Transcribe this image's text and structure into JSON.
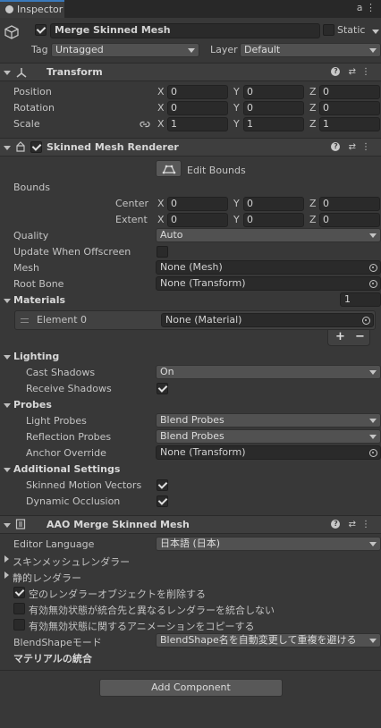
{
  "tab": {
    "title": "Inspector"
  },
  "object": {
    "name": "Merge Skinned Mesh",
    "static_label": "Static",
    "tag_label": "Tag",
    "tag_value": "Untagged",
    "layer_label": "Layer",
    "layer_value": "Default"
  },
  "transform": {
    "title": "Transform",
    "position": {
      "label": "Position",
      "x": "0",
      "y": "0",
      "z": "0"
    },
    "rotation": {
      "label": "Rotation",
      "x": "0",
      "y": "0",
      "z": "0"
    },
    "scale": {
      "label": "Scale",
      "x": "1",
      "y": "1",
      "z": "1"
    }
  },
  "axes": {
    "x": "X",
    "y": "Y",
    "z": "Z"
  },
  "smr": {
    "title": "Skinned Mesh Renderer",
    "edit_bounds": "Edit Bounds",
    "bounds_label": "Bounds",
    "center": {
      "label": "Center",
      "x": "0",
      "y": "0",
      "z": "0"
    },
    "extent": {
      "label": "Extent",
      "x": "0",
      "y": "0",
      "z": "0"
    },
    "quality_label": "Quality",
    "quality_value": "Auto",
    "update_offscreen_label": "Update When Offscreen",
    "mesh_label": "Mesh",
    "mesh_value": "None (Mesh)",
    "root_bone_label": "Root Bone",
    "root_bone_value": "None (Transform)",
    "materials_label": "Materials",
    "materials_count": "1",
    "element0_label": "Element 0",
    "element0_value": "None (Material)",
    "plus": "+",
    "minus": "−",
    "lighting_label": "Lighting",
    "cast_shadows_label": "Cast Shadows",
    "cast_shadows_value": "On",
    "receive_shadows_label": "Receive Shadows",
    "probes_label": "Probes",
    "light_probes_label": "Light Probes",
    "light_probes_value": "Blend Probes",
    "reflection_probes_label": "Reflection Probes",
    "reflection_probes_value": "Blend Probes",
    "anchor_override_label": "Anchor Override",
    "anchor_override_value": "None (Transform)",
    "additional_label": "Additional Settings",
    "skinned_motion_label": "Skinned Motion Vectors",
    "dynamic_occlusion_label": "Dynamic Occlusion"
  },
  "aao": {
    "title": "AAO Merge Skinned Mesh",
    "editor_language_label": "Editor Language",
    "editor_language_value": "日本語 (日本)",
    "skinned_renderers_label": "スキンメッシュレンダラー",
    "static_renderers_label": "静的レンダラー",
    "remove_empty_label": "空のレンダラーオブジェクトを削除する",
    "skip_enable_label": "有効無効状態が統合先と異なるレンダラーを統合しない",
    "copy_anim_label": "有効無効状態に関するアニメーションをコピーする",
    "blendshape_mode_label": "BlendShapeモード",
    "blendshape_mode_value": "BlendShape名を自動変更して重複を避ける",
    "material_merge_label": "マテリアルの統合"
  },
  "add_component": "Add Component",
  "colors": {
    "background": "#383838",
    "header": "#3e3e3e",
    "field": "#2a2a2a",
    "dropdown": "#515151",
    "tab_accent": "#3a79bb"
  }
}
